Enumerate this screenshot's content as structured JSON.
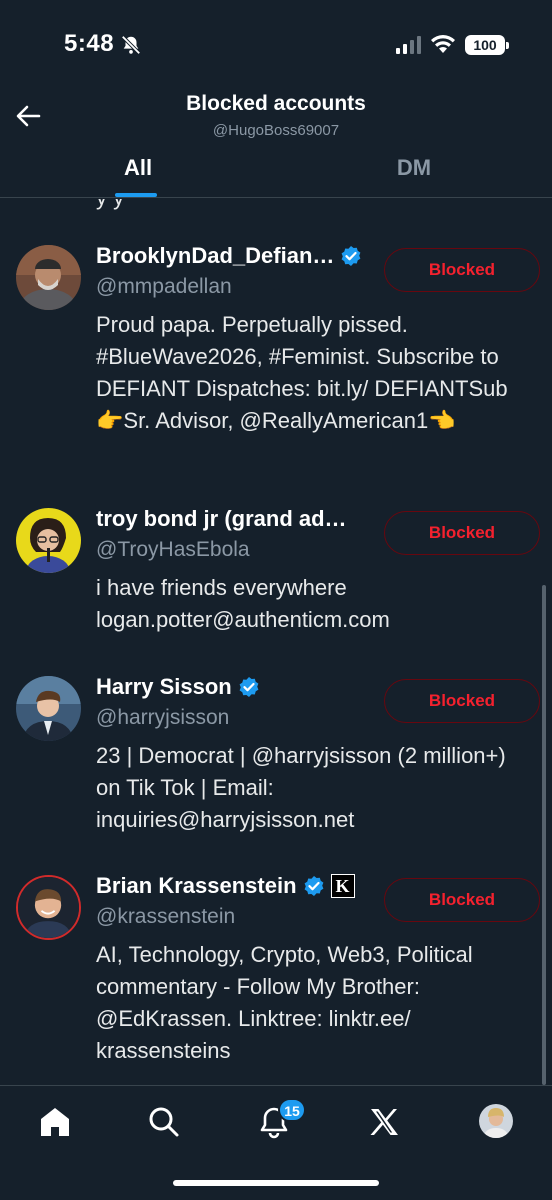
{
  "status_bar": {
    "time": "5:48",
    "battery": "100"
  },
  "header": {
    "title": "Blocked accounts",
    "subtitle": "@HugoBoss69007"
  },
  "tabs": [
    {
      "label": "All",
      "active": true
    },
    {
      "label": "DM",
      "active": false
    }
  ],
  "list": {
    "cut_text": "y y",
    "rows": [
      {
        "name": "BrooklynDad_Defian…",
        "verified": true,
        "handle": "@mmpadellan",
        "bio": "Proud papa. Perpetually pissed. #BlueWave2026, #Feminist. Subscribe to DEFIANT Dispatches: bit.ly/ DEFIANTSub 👉Sr. Advisor, @ReallyAmerican1👈",
        "button": "Blocked"
      },
      {
        "name": "troy bond jr (grand ad…",
        "verified": false,
        "handle": "@TroyHasEbola",
        "bio": "i have friends everywhere logan.potter@authenticm.com",
        "button": "Blocked"
      },
      {
        "name": "Harry Sisson",
        "verified": true,
        "handle": "@harryjsisson",
        "bio": "23 | Democrat | @harryjsisson (2 million+) on Tik Tok | Email: inquiries@harryjsisson.net",
        "button": "Blocked"
      },
      {
        "name": "Brian Krassenstein",
        "verified": true,
        "affiliate_badge": "K",
        "handle": "@krassenstein",
        "bio": "AI, Technology, Crypto, Web3, Political commentary - Follow My Brother: @EdKrassen. Linktree: linktr.ee/ krassensteins",
        "button": "Blocked"
      }
    ]
  },
  "bottom_nav": {
    "items": [
      "home-icon",
      "search-icon",
      "notifications-icon",
      "x-logo-icon",
      "profile-avatar"
    ],
    "notification_count": "15"
  },
  "colors": {
    "background": "#15202b",
    "accent": "#1d9bf0",
    "blocked_red": "#f4212e",
    "muted": "#8b98a5"
  }
}
